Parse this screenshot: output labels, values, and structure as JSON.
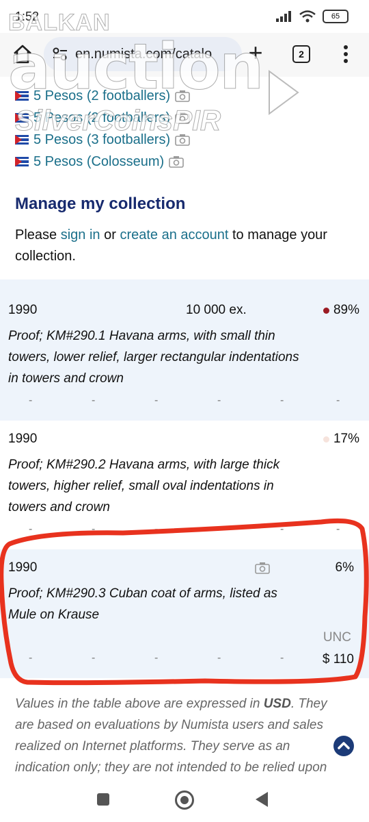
{
  "status_bar": {
    "time": "1:52",
    "battery": "65"
  },
  "browser": {
    "url": "en.numista.com/catalo",
    "tab_count": "2",
    "new_tab": "+"
  },
  "watermark": {
    "line1": "BALKAN",
    "line2": "auction",
    "line3": "SilverCoinsPIR"
  },
  "related_links": [
    {
      "label": "5 Pesos (2 footballers)",
      "flag": "cuba-flag",
      "icon": "camera-icon"
    },
    {
      "label": "5 Pesos (2 footballers)",
      "flag": "cuba-flag",
      "icon": "camera-icon"
    },
    {
      "label": "5 Pesos (3 footballers)",
      "flag": "cuba-flag",
      "icon": "camera-icon"
    },
    {
      "label": "5 Pesos (Colosseum)",
      "flag": "cuba-flag",
      "icon": "camera-icon"
    }
  ],
  "manage": {
    "title": "Manage my collection",
    "text_before": "Please ",
    "sign_in": "sign in",
    "text_mid": " or ",
    "create_account": "create an account",
    "text_after": " to manage your collection."
  },
  "table_rows": [
    {
      "year": "1990",
      "mintage": "10 000 ex.",
      "percent": "89%",
      "dot_color": "#9b1b24",
      "description": "Proof; KM#290.1 Havana arms, with small thin towers, lower relief, larger rectangular indentations in towers and crown",
      "values": [
        "-",
        "-",
        "-",
        "-",
        "-",
        "-"
      ]
    },
    {
      "year": "1990",
      "mintage": "",
      "percent": "17%",
      "dot_color": "#f6e3dc",
      "description": "Proof; KM#290.2 Havana arms, with large thick towers, higher relief, small oval indentations in towers and crown",
      "values": [
        "-",
        "-",
        "-",
        "-",
        "-",
        "-"
      ]
    },
    {
      "year": "1990",
      "mintage": "",
      "percent": "6%",
      "description": "Proof; KM#290.3 Cuban coat of arms, listed as Mule on Krause",
      "values": [
        "-",
        "-",
        "-",
        "-",
        "-"
      ],
      "grade": "UNC",
      "price": "$ 110"
    }
  ],
  "note": {
    "before": "Values in the table above are expressed in ",
    "currency": "USD",
    "after": ". They are based on evaluations by Numista users and sales realized on Internet platforms. They serve as an indication only; they are not intended to be relied upon"
  },
  "colors": {
    "link": "#1a6f8a",
    "heading": "#172a6e",
    "row_bg": "#eef4fb",
    "annotation": "#e8321e"
  }
}
